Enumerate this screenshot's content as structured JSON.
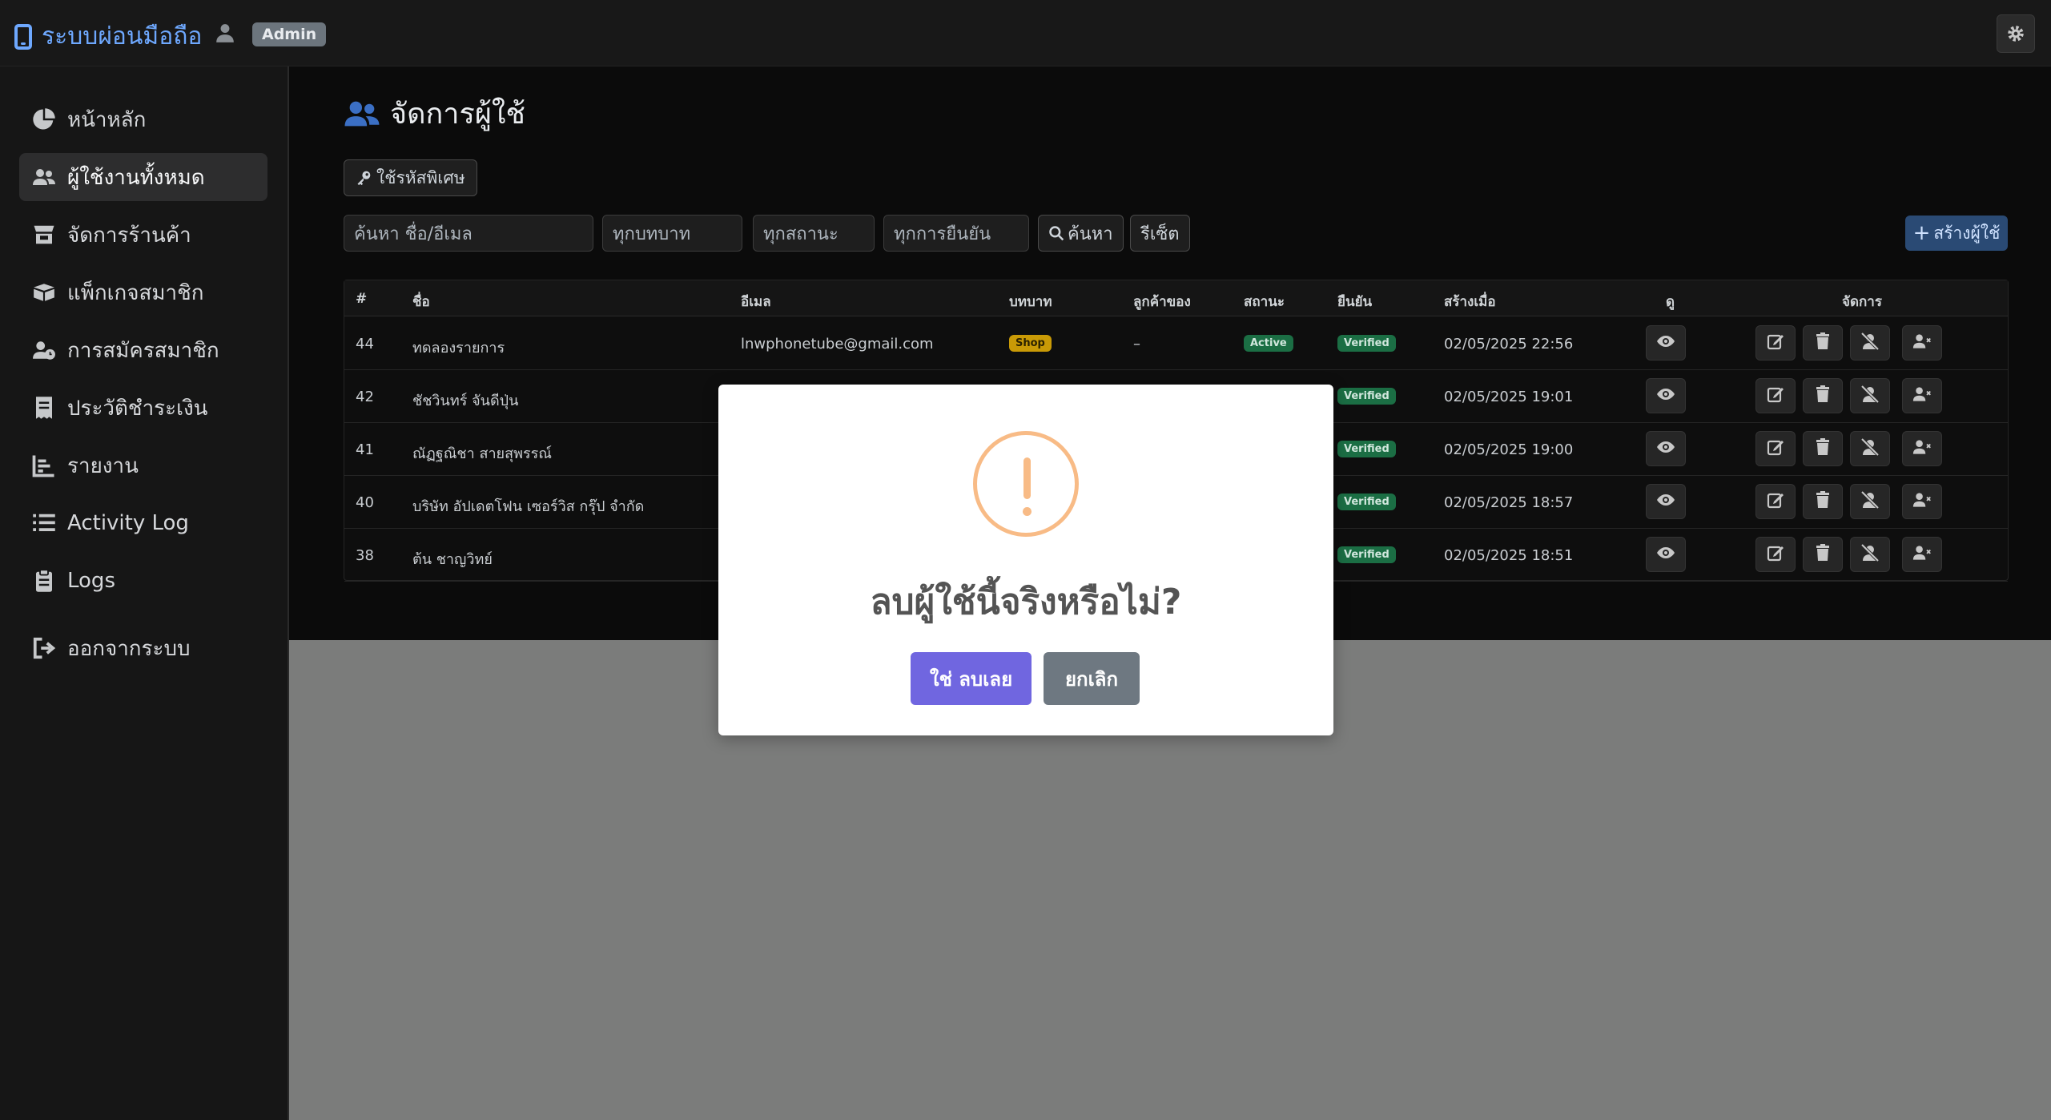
{
  "header": {
    "brand": "ระบบผ่อนมือถือ",
    "role_badge": "Admin"
  },
  "sidebar": {
    "items": [
      {
        "label": "หน้าหลัก",
        "icon": "chart-pie-icon"
      },
      {
        "label": "ผู้ใช้งานทั้งหมด",
        "icon": "users-icon",
        "active": true
      },
      {
        "label": "จัดการร้านค้า",
        "icon": "store-icon"
      },
      {
        "label": "แพ็กเกจสมาชิก",
        "icon": "boxes-icon"
      },
      {
        "label": "การสมัครสมาชิก",
        "icon": "user-clock-icon"
      },
      {
        "label": "ประวัติชำระเงิน",
        "icon": "receipt-icon"
      },
      {
        "label": "รายงาน",
        "icon": "chart-bar-icon"
      },
      {
        "label": "Activity Log",
        "icon": "list-icon"
      },
      {
        "label": "Logs",
        "icon": "clipboard-icon"
      },
      {
        "label": "ออกจากระบบ",
        "icon": "sign-out-icon"
      }
    ]
  },
  "page": {
    "title": "จัดการผู้ใช้",
    "special_button": "ใช้รหัสพิเศษ"
  },
  "filters": {
    "search_placeholder": "ค้นหา ชื่อ/อีเมล",
    "role_select": "ทุกบทบาท",
    "status_select": "ทุกสถานะ",
    "verify_select": "ทุกการยืนยัน",
    "search_button": "ค้นหา",
    "reset_button": "รีเซ็ต",
    "create_button": "สร้างผู้ใช้"
  },
  "table": {
    "headers": [
      "#",
      "ชื่อ",
      "อีเมล",
      "บทบาท",
      "ลูกค้าของ",
      "สถานะ",
      "ยืนยัน",
      "สร้างเมื่อ",
      "ดู",
      "จัดการ"
    ],
    "rows": [
      {
        "id": "44",
        "name": "ทดลองรายการ",
        "email": "lnwphonetube@gmail.com",
        "role": "Shop",
        "owner": "–",
        "status": "Active",
        "verified": "Verified",
        "created": "02/05/2025 22:56"
      },
      {
        "id": "42",
        "name": "ชัชวินทร์ จันดีปุ่น",
        "verified": "Verified",
        "created": "02/05/2025 19:01"
      },
      {
        "id": "41",
        "name": "ณัฏฐณิชา สายสุพรรณ์",
        "verified": "Verified",
        "created": "02/05/2025 19:00"
      },
      {
        "id": "40",
        "name": "บริษัท อัปเดตโฟน เซอร์วิส กรุ๊ป จำกัด",
        "verified": "Verified",
        "created": "02/05/2025 18:57"
      },
      {
        "id": "38",
        "name": "ต้น ชาญวิทย์",
        "verified": "Verified",
        "created": "02/05/2025 18:51"
      }
    ]
  },
  "modal": {
    "icon": "warning-icon",
    "title": "ลบผู้ใช้นี้จริงหรือไม่?",
    "confirm": "ใช่ ลบเลย",
    "cancel": "ยกเลิก"
  },
  "colors": {
    "accent": "#6ea8fe",
    "confirm": "#7066e0",
    "cancel": "#6e7881",
    "warning": "#f8bb86",
    "badge_success": "#1b6e44",
    "badge_shop": "#c99a06"
  }
}
